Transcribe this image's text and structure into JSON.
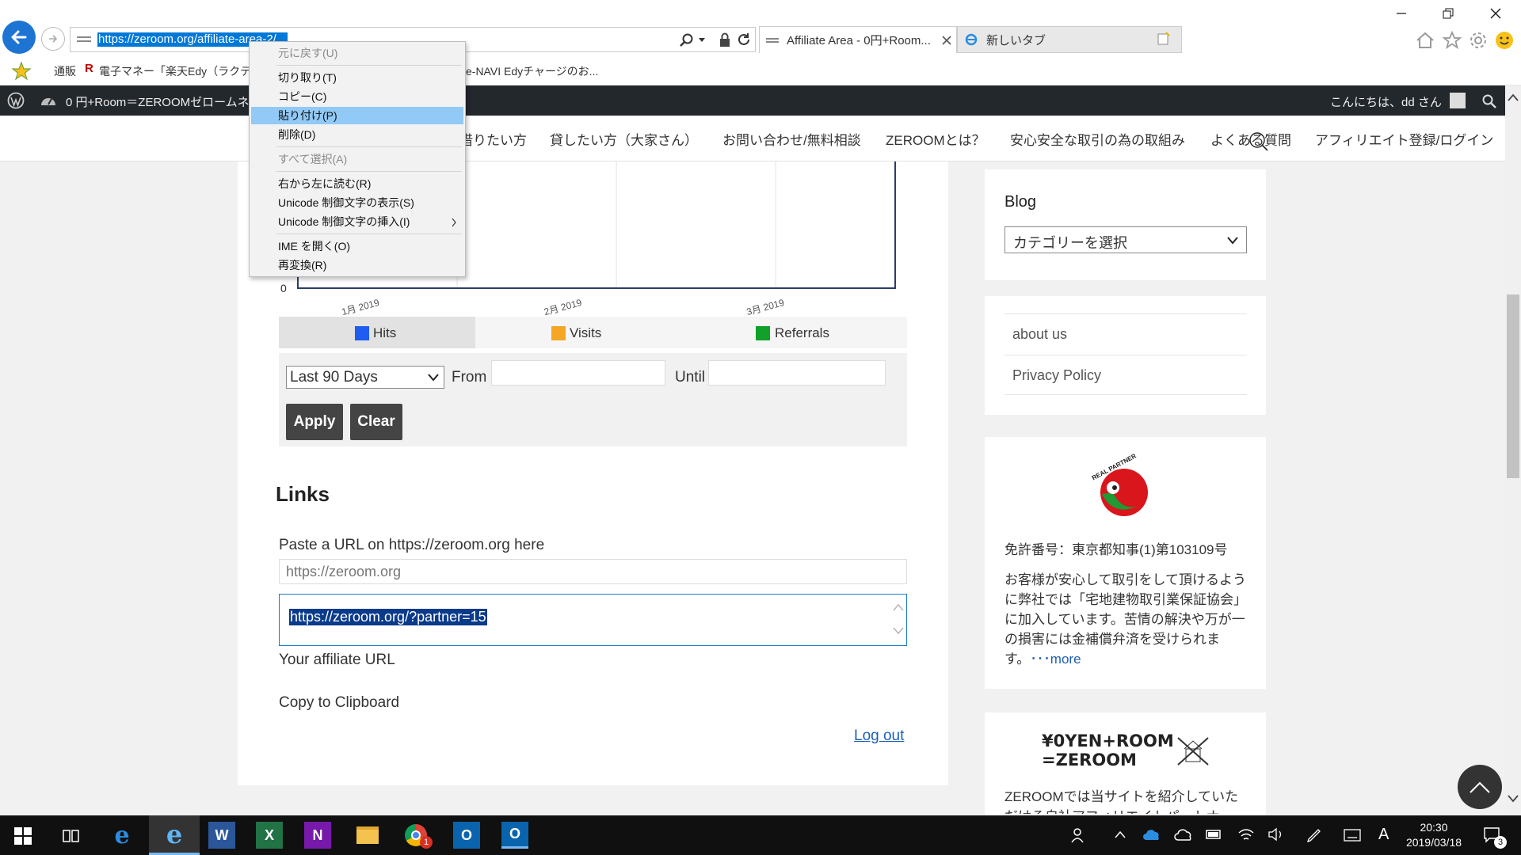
{
  "browser": {
    "url": "https://zeroom.org/affiliate-area-2/",
    "tabs": [
      {
        "title": "Affiliate Area - 0円+Room..."
      },
      {
        "title": "新しいタブ"
      }
    ],
    "favorites": [
      {
        "label": "通販"
      },
      {
        "label": "電子マネー「楽天Edy（ラクテ..."
      },
      {
        "label": "e-NAVI Edyチャージのお..."
      }
    ]
  },
  "context_menu": {
    "items": [
      {
        "label": "元に戻す(U)",
        "enabled": false
      },
      {
        "label": "切り取り(T)",
        "enabled": true
      },
      {
        "label": "コピー(C)",
        "enabled": true
      },
      {
        "label": "貼り付け(P)",
        "enabled": true,
        "highlighted": true
      },
      {
        "label": "削除(D)",
        "enabled": true
      },
      {
        "label": "すべて選択(A)",
        "enabled": false
      },
      {
        "label": "右から左に読む(R)",
        "enabled": true
      },
      {
        "label": "Unicode 制御文字の表示(S)",
        "enabled": true
      },
      {
        "label": "Unicode 制御文字の挿入(I)",
        "enabled": true,
        "submenu": true
      },
      {
        "label": "IME を開く(O)",
        "enabled": true
      },
      {
        "label": "再変換(R)",
        "enabled": true
      }
    ]
  },
  "wp_admin_bar": {
    "site_title": "0 円+Room＝ZEROOMゼロームネ",
    "greeting": "こんにちは、dd さん"
  },
  "site_nav": {
    "items": [
      {
        "label": "借りたい方"
      },
      {
        "label": "貸したい方（大家さん）"
      },
      {
        "label": "お問い合わせ/無料相談"
      },
      {
        "label": "ZEROOMとは？"
      },
      {
        "label": "安心安全な取引の為の取組み"
      },
      {
        "label": "よくある質問"
      },
      {
        "label": "アフィリエイト登録/ログイン"
      }
    ]
  },
  "chart_data": {
    "type": "line",
    "x": [
      "1月 2019",
      "2月 2019",
      "3月 2019"
    ],
    "series": [
      {
        "name": "Hits",
        "color": "#1f5cf0",
        "values": [
          0,
          0,
          0
        ]
      },
      {
        "name": "Visits",
        "color": "#f5a623",
        "values": [
          0,
          0,
          0
        ]
      },
      {
        "name": "Referrals",
        "color": "#11a028",
        "values": [
          0,
          0,
          0
        ]
      }
    ],
    "y_tick_visible": "0",
    "legend_position": "bottom"
  },
  "date_filter": {
    "range_selected": "Last 90 Days",
    "from_label": "From",
    "until_label": "Until",
    "apply_label": "Apply",
    "clear_label": "Clear"
  },
  "links_section": {
    "heading": "Links",
    "paste_label": "Paste a URL on https://zeroom.org here",
    "url_placeholder": "https://zeroom.org",
    "affiliate_url": "https://zeroom.org/?partner=15",
    "affiliate_url_label": "Your affiliate URL",
    "copy_label": "Copy to Clipboard",
    "logout_label": "Log out"
  },
  "sidebar": {
    "blog_heading": "Blog",
    "category_select": "カテゴリーを選択",
    "links": [
      {
        "label": "about us"
      },
      {
        "label": "Privacy Policy"
      }
    ],
    "license_badge_text": "REAL PARTNER",
    "license": "免許番号：東京都知事(1)第103109号",
    "description": "お客様が安心して取引をして頂けるように弊社では「宅地建物取引業保証協会」に加入しています。苦情の解決や万が一の損害には金補償弁済を受けられます。",
    "more_link": "･･･more",
    "zeroom_logo_line1": "¥0YEN+ROOM",
    "zeroom_logo_line2": "=ZEROOM",
    "zeroom_text": "ZEROOMでは当サイトを紹介していただける自社アフィリエイトパートナ"
  },
  "taskbar": {
    "time": "20:30",
    "date": "2019/03/18",
    "ime": "A",
    "notification_count": "3",
    "chrome_badge": "1"
  }
}
